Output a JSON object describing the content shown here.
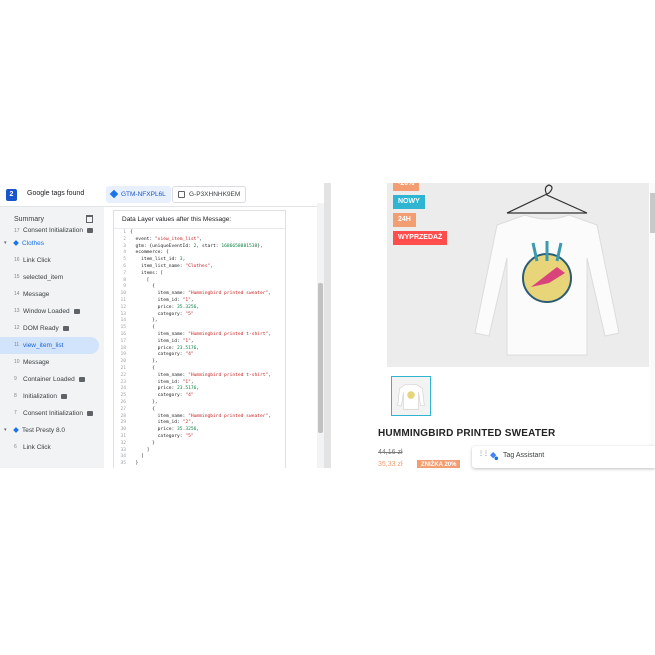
{
  "topbar": {
    "count": "2",
    "found_label": "Google tags found",
    "tabs": [
      {
        "label": "GTM-NFXPL6L",
        "active": true
      },
      {
        "label": "G-P3XHNHK9EM",
        "active": false
      }
    ]
  },
  "sidebar": {
    "summary_label": "Summary",
    "events": [
      {
        "num": "17",
        "label": "Consent Initialization",
        "type": "cut",
        "mini": true
      },
      {
        "num": "",
        "label": "Clothes",
        "type": "group"
      },
      {
        "num": "16",
        "label": "Link Click",
        "type": "item"
      },
      {
        "num": "15",
        "label": "selected_item",
        "type": "item"
      },
      {
        "num": "14",
        "label": "Message",
        "type": "item"
      },
      {
        "num": "13",
        "label": "Window Loaded",
        "type": "item",
        "mini": true
      },
      {
        "num": "12",
        "label": "DOM Ready",
        "type": "item",
        "mini": true
      },
      {
        "num": "11",
        "label": "view_item_list",
        "type": "selected"
      },
      {
        "num": "10",
        "label": "Message",
        "type": "item"
      },
      {
        "num": "9",
        "label": "Container Loaded",
        "type": "item",
        "mini": true
      },
      {
        "num": "8",
        "label": "Initialization",
        "type": "item",
        "mini": true
      },
      {
        "num": "7",
        "label": "Consent Initialization",
        "type": "item",
        "mini": true
      },
      {
        "num": "",
        "label": "Test Presty 8.0",
        "type": "group2"
      },
      {
        "num": "6",
        "label": "Link Click",
        "type": "item"
      }
    ]
  },
  "panel": {
    "title": "Data Layer values after this Message:",
    "lines": [
      [
        [
          "p",
          "{"
        ]
      ],
      [
        [
          "p",
          "  event: "
        ],
        [
          "s",
          "\"view_item_list\""
        ],
        [
          "p",
          ","
        ]
      ],
      [
        [
          "p",
          "  gtm: {uniqueEventId: "
        ],
        [
          "n",
          "2"
        ],
        [
          "p",
          ", start: "
        ],
        [
          "n",
          "1686658881538"
        ],
        [
          "p",
          "},"
        ]
      ],
      [
        [
          "p",
          "  ecommerce: {"
        ]
      ],
      [
        [
          "p",
          "    item_list_id: "
        ],
        [
          "n",
          "3"
        ],
        [
          "p",
          ","
        ]
      ],
      [
        [
          "p",
          "    item_list_name: "
        ],
        [
          "s",
          "\"Clothes\""
        ],
        [
          "p",
          ","
        ]
      ],
      [
        [
          "p",
          "    items: ["
        ]
      ],
      [
        [
          "p",
          "      ["
        ]
      ],
      [
        [
          "p",
          "        {"
        ]
      ],
      [
        [
          "p",
          "          item_name: "
        ],
        [
          "s",
          "\"Hummingbird printed sweater\""
        ],
        [
          "p",
          ","
        ]
      ],
      [
        [
          "p",
          "          item_id: "
        ],
        [
          "s",
          "\"1\""
        ],
        [
          "p",
          ","
        ]
      ],
      [
        [
          "p",
          "          price: "
        ],
        [
          "n",
          "35.3256"
        ],
        [
          "p",
          ","
        ]
      ],
      [
        [
          "p",
          "          category: "
        ],
        [
          "s",
          "\"5\""
        ]
      ],
      [
        [
          "p",
          "        },"
        ]
      ],
      [
        [
          "p",
          "        {"
        ]
      ],
      [
        [
          "p",
          "          item_name: "
        ],
        [
          "s",
          "\"Hummingbird printed t-shirt\""
        ],
        [
          "p",
          ","
        ]
      ],
      [
        [
          "p",
          "          item_id: "
        ],
        [
          "s",
          "\"1\""
        ],
        [
          "p",
          ","
        ]
      ],
      [
        [
          "p",
          "          price: "
        ],
        [
          "n",
          "23.5176"
        ],
        [
          "p",
          ","
        ]
      ],
      [
        [
          "p",
          "          category: "
        ],
        [
          "s",
          "\"4\""
        ]
      ],
      [
        [
          "p",
          "        },"
        ]
      ],
      [
        [
          "p",
          "        {"
        ]
      ],
      [
        [
          "p",
          "          item_name: "
        ],
        [
          "s",
          "\"Hummingbird printed t-shirt\""
        ],
        [
          "p",
          ","
        ]
      ],
      [
        [
          "p",
          "          item_id: "
        ],
        [
          "s",
          "\"1\""
        ],
        [
          "p",
          ","
        ]
      ],
      [
        [
          "p",
          "          price: "
        ],
        [
          "n",
          "23.5176"
        ],
        [
          "p",
          ","
        ]
      ],
      [
        [
          "p",
          "          category: "
        ],
        [
          "s",
          "\"4\""
        ]
      ],
      [
        [
          "p",
          "        },"
        ]
      ],
      [
        [
          "p",
          "        {"
        ]
      ],
      [
        [
          "p",
          "          item_name: "
        ],
        [
          "s",
          "\"Hummingbird printed sweater\""
        ],
        [
          "p",
          ","
        ]
      ],
      [
        [
          "p",
          "          item_id: "
        ],
        [
          "s",
          "\"2\""
        ],
        [
          "p",
          ","
        ]
      ],
      [
        [
          "p",
          "          price: "
        ],
        [
          "n",
          "35.3256"
        ],
        [
          "p",
          ","
        ]
      ],
      [
        [
          "p",
          "          category: "
        ],
        [
          "s",
          "\"5\""
        ]
      ],
      [
        [
          "p",
          "        }"
        ]
      ],
      [
        [
          "p",
          "      ]"
        ]
      ],
      [
        [
          "p",
          "    ]"
        ]
      ],
      [
        [
          "p",
          "  }"
        ]
      ]
    ]
  },
  "shop": {
    "labels": [
      {
        "text": "-20%",
        "color": "#f39d72"
      },
      {
        "text": "NOWY",
        "color": "#2fb5d2"
      },
      {
        "text": "24H",
        "color": "#f39d72"
      },
      {
        "text": "WYPRZEDAŻ",
        "color": "#ff4c4c"
      }
    ],
    "product_title": "HUMMINGBIRD PRINTED SWEATER",
    "old_price": "44,16 zł",
    "new_price": "35,33 zł",
    "discount": "ZNIŻKA 20%"
  },
  "tag_assistant": {
    "label": "Tag Assistant"
  }
}
